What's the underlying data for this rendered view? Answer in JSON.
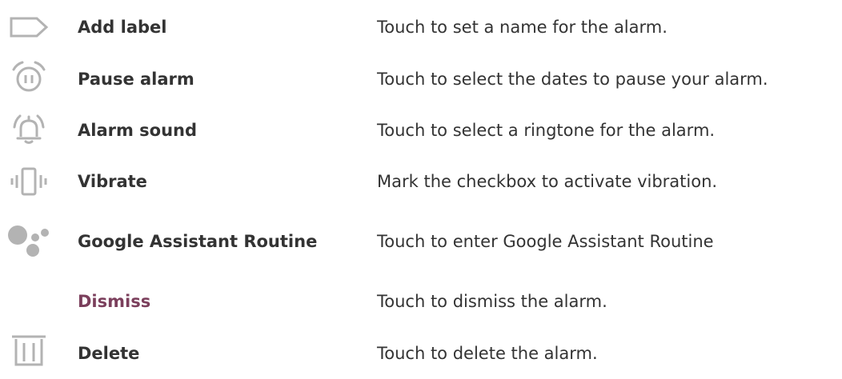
{
  "colors": {
    "text": "#333333",
    "accent": "#7b3f5c",
    "icon": "#b3b3b3"
  },
  "rows": [
    {
      "icon": "label-tag-icon",
      "label": "Add label",
      "description": "Touch to set a name for the alarm."
    },
    {
      "icon": "pause-alarm-icon",
      "label": "Pause alarm",
      "description": "Touch to select the dates to pause your alarm."
    },
    {
      "icon": "alarm-bell-icon",
      "label": "Alarm sound",
      "description": "Touch to select a ringtone for the alarm."
    },
    {
      "icon": "vibrate-phone-icon",
      "label": "Vibrate",
      "description": "Mark the checkbox to activate vibration."
    },
    {
      "icon": "google-assistant-icon",
      "label": "Google Assistant Routine",
      "description": "Touch to enter Google Assistant Routine"
    },
    {
      "icon": "",
      "label": "Dismiss",
      "description": "Touch to dismiss the alarm."
    },
    {
      "icon": "trash-can-icon",
      "label": "Delete",
      "description": "Touch to delete the alarm."
    }
  ]
}
